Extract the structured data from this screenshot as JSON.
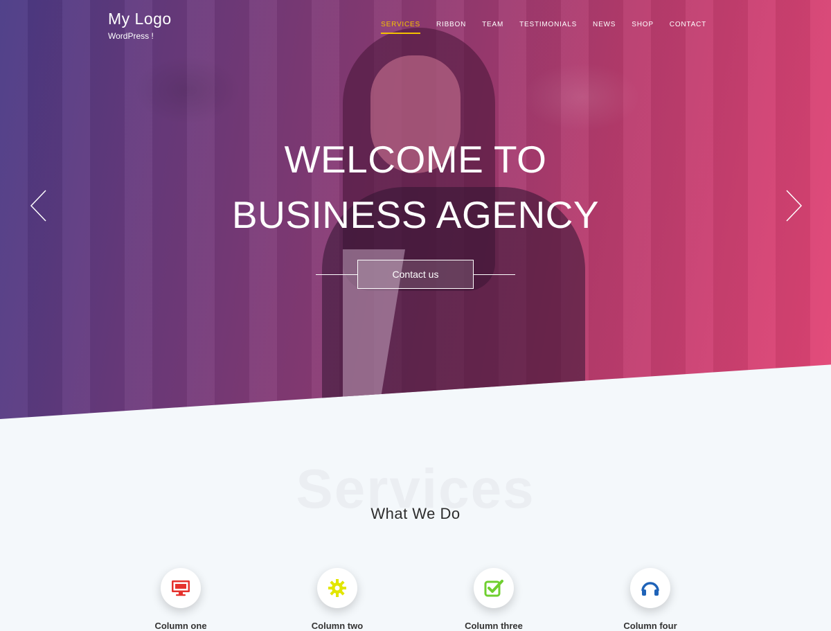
{
  "logo": {
    "title": "My Logo",
    "subtitle": "WordPress !"
  },
  "nav": {
    "items": [
      "SERVICES",
      "RIBBON",
      "TEAM",
      "TESTIMONIALS",
      "NEWS",
      "SHOP",
      "CONTACT"
    ],
    "active": "SERVICES"
  },
  "hero": {
    "title_line1": "WELCOME TO",
    "title_line2": "BUSINESS AGENCY",
    "cta_label": "Contact us",
    "prev_icon": "chevron-left-icon",
    "next_icon": "chevron-right-icon"
  },
  "services": {
    "bg_text": "Services",
    "heading": "What We Do",
    "features": [
      {
        "icon": "monitor-icon",
        "color": "#e5322d",
        "label": "Column one"
      },
      {
        "icon": "gear-icon",
        "color": "#e2e600",
        "label": "Column two"
      },
      {
        "icon": "checkbox-icon",
        "color": "#6fcf2f",
        "label": "Column three"
      },
      {
        "icon": "headphones-icon",
        "color": "#1f63b8",
        "label": "Column four"
      }
    ]
  },
  "colors": {
    "accent": "#f5c200",
    "gradient_start": "#4a3a86",
    "gradient_end": "#e34576",
    "section_bg": "#f4f8fb"
  }
}
